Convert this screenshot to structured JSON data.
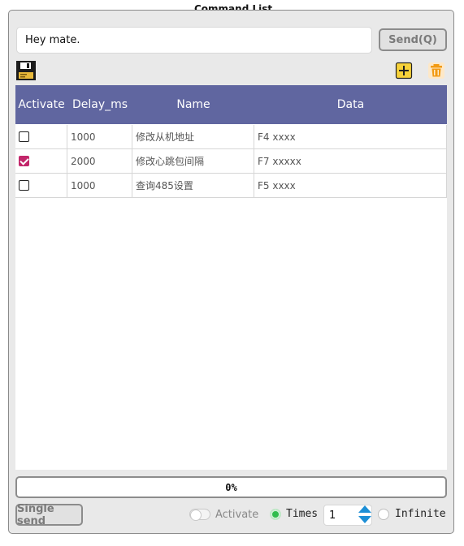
{
  "panel": {
    "title": "Command List"
  },
  "command_input": {
    "value": "Hey mate."
  },
  "buttons": {
    "send": "Send(Q)",
    "single_send": "Single send"
  },
  "icons": {
    "save": "save-icon",
    "add": "add-icon",
    "delete": "delete-icon"
  },
  "table": {
    "headers": [
      "Activate",
      "Delay_ms",
      "Name",
      "Data"
    ],
    "rows": [
      {
        "activate": false,
        "delay": "1000",
        "name": "修改从机地址",
        "data": "F4 xxxx"
      },
      {
        "activate": true,
        "delay": "2000",
        "name": "修改心跳包间隔",
        "data": "F7 xxxxx"
      },
      {
        "activate": false,
        "delay": "1000",
        "name": "查询485设置",
        "data": "F5 xxxx"
      }
    ]
  },
  "progress": {
    "text": "0%",
    "value": 0
  },
  "controls": {
    "activate_label": "Activate",
    "activate_on": false,
    "times_label": "Times",
    "times_selected": true,
    "times_value": "1",
    "infinite_label": "Infinite",
    "infinite_selected": false
  },
  "colors": {
    "header_bg": "#6066a0",
    "check_accent": "#c2266a",
    "radio_on": "#2fbd4c",
    "spin_arrow": "#1d8fd6"
  }
}
